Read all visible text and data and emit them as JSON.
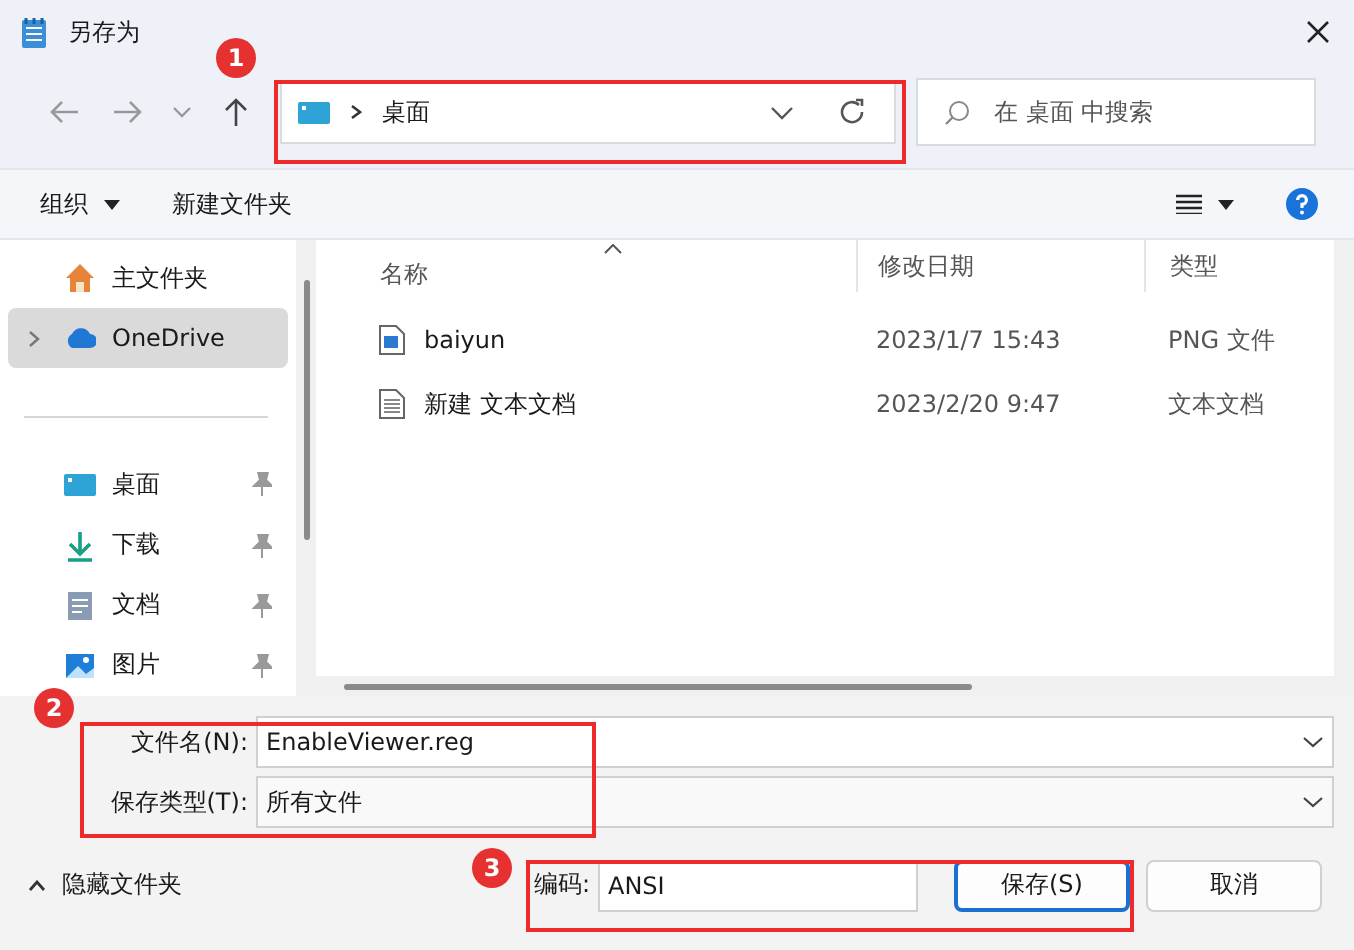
{
  "window": {
    "title": "另存为"
  },
  "nav": {
    "path": "桌面",
    "search_placeholder": "在 桌面 中搜索"
  },
  "toolbar": {
    "organize": "组织",
    "new_folder": "新建文件夹"
  },
  "sidebar": {
    "items": [
      {
        "label": "主文件夹",
        "kind": "home",
        "selected": false,
        "pinned": false
      },
      {
        "label": "OneDrive",
        "kind": "cloud",
        "selected": true,
        "pinned": false
      },
      {
        "label": "桌面",
        "kind": "desktop",
        "selected": false,
        "pinned": true
      },
      {
        "label": "下载",
        "kind": "download",
        "selected": false,
        "pinned": true
      },
      {
        "label": "文档",
        "kind": "document",
        "selected": false,
        "pinned": true
      },
      {
        "label": "图片",
        "kind": "picture",
        "selected": false,
        "pinned": true
      }
    ]
  },
  "table": {
    "columns": [
      "名称",
      "修改日期",
      "类型"
    ],
    "rows": [
      {
        "name": "baiyun",
        "kind": "image",
        "date": "2023/1/7 15:43",
        "type": "PNG 文件"
      },
      {
        "name": "新建 文本文档",
        "kind": "text",
        "date": "2023/2/20 9:47",
        "type": "文本文档"
      }
    ]
  },
  "form": {
    "filename_label": "文件名(N):",
    "filename": "EnableViewer.reg",
    "filetype_label": "保存类型(T):",
    "filetype": "所有文件"
  },
  "footer": {
    "hide_folders": "隐藏文件夹",
    "encoding_label": "编码:",
    "encoding": "ANSI",
    "save": "保存(S)",
    "cancel": "取消"
  },
  "annotations": [
    {
      "number": "1"
    },
    {
      "number": "2"
    },
    {
      "number": "3"
    }
  ]
}
